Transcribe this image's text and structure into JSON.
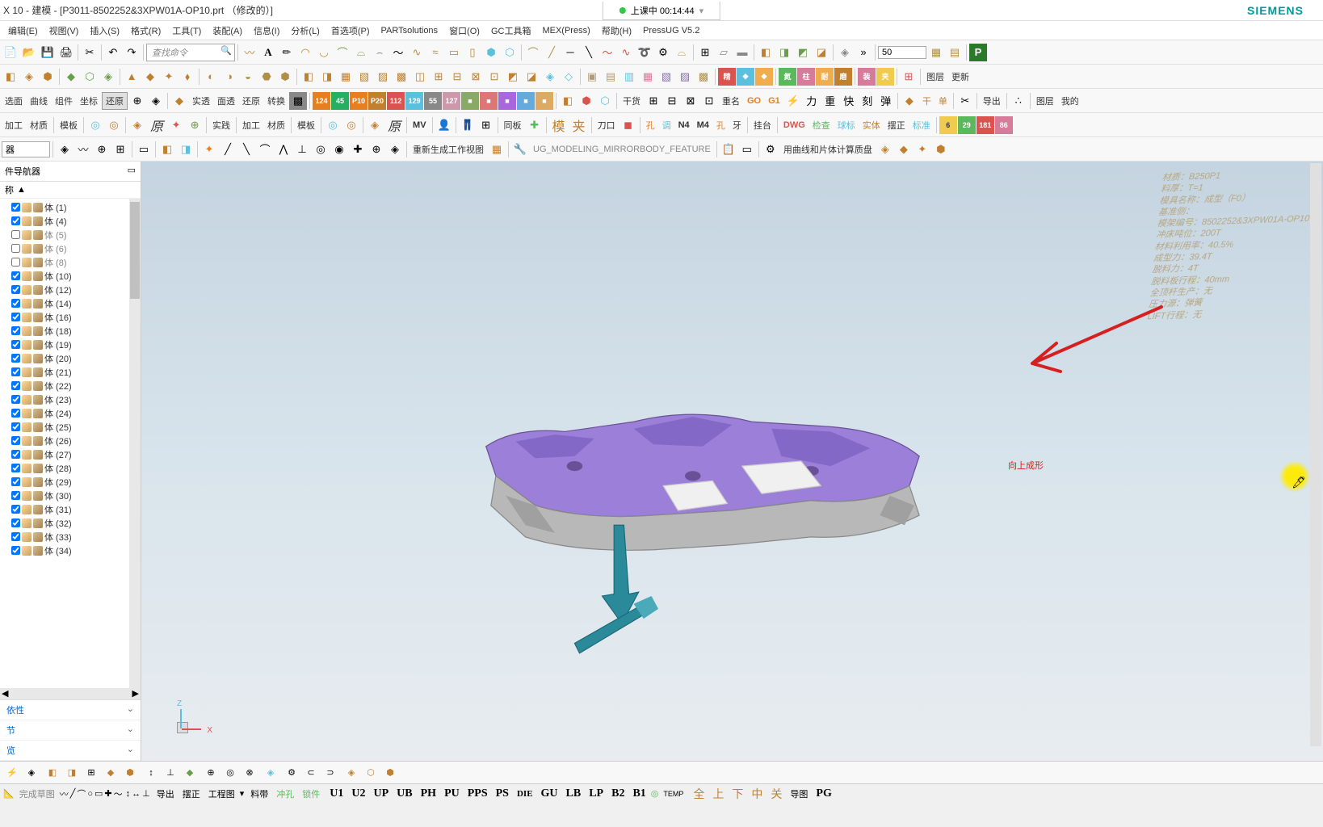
{
  "window": {
    "title": "X 10 - 建模 - [P3011-8502252&3XPW01A-OP10.prt （修改的）]",
    "brand": "SIEMENS"
  },
  "recording": {
    "label": "上课中 00:14:44",
    "arrow": "▾"
  },
  "menu": [
    "编辑(E)",
    "视图(V)",
    "插入(S)",
    "格式(R)",
    "工具(T)",
    "装配(A)",
    "信息(I)",
    "分析(L)",
    "首选项(P)",
    "PARTsolutions",
    "窗口(O)",
    "GC工具箱",
    "MEX(Press)",
    "帮助(H)",
    "PressUG V5.2"
  ],
  "search_placeholder": "查找命令",
  "combo_50": "50",
  "nav": {
    "title": "件导航器",
    "col": "称",
    "items": [
      {
        "label": "体 (1)",
        "checked": true
      },
      {
        "label": "体 (4)",
        "checked": true
      },
      {
        "label": "体 (5)",
        "checked": false
      },
      {
        "label": "体 (6)",
        "checked": false
      },
      {
        "label": "体 (8)",
        "checked": false
      },
      {
        "label": "体 (10)",
        "checked": true
      },
      {
        "label": "体 (12)",
        "checked": true
      },
      {
        "label": "体 (14)",
        "checked": true
      },
      {
        "label": "体 (16)",
        "checked": true
      },
      {
        "label": "体 (18)",
        "checked": true
      },
      {
        "label": "体 (19)",
        "checked": true
      },
      {
        "label": "体 (20)",
        "checked": true
      },
      {
        "label": "体 (21)",
        "checked": true
      },
      {
        "label": "体 (22)",
        "checked": true
      },
      {
        "label": "体 (23)",
        "checked": true
      },
      {
        "label": "体 (24)",
        "checked": true
      },
      {
        "label": "体 (25)",
        "checked": true
      },
      {
        "label": "体 (26)",
        "checked": true
      },
      {
        "label": "体 (27)",
        "checked": true
      },
      {
        "label": "体 (28)",
        "checked": true
      },
      {
        "label": "体 (29)",
        "checked": true
      },
      {
        "label": "体 (30)",
        "checked": true
      },
      {
        "label": "体 (31)",
        "checked": true
      },
      {
        "label": "体 (32)",
        "checked": true
      },
      {
        "label": "体 (33)",
        "checked": true
      },
      {
        "label": "体 (34)",
        "checked": true
      }
    ]
  },
  "accordion": [
    "依性",
    "节",
    "览"
  ],
  "toolbar_labels": {
    "row2_labels": [
      "选面",
      "曲线",
      "组件",
      "坐标",
      "还原",
      "实透",
      "面透",
      "还原",
      "转换",
      "GO",
      "G1"
    ],
    "row3_labels": [
      "加工",
      "材质",
      "模板",
      "原",
      "实践",
      "加工",
      "材质",
      "模板",
      "原",
      "MV",
      "模",
      "夹",
      "刀口",
      "孔",
      "调",
      "N4",
      "M4",
      "孔",
      "牙",
      "挂台",
      "DWG",
      "检查",
      "球标",
      "实体",
      "摆正",
      "标准"
    ],
    "row4_labels": [
      "重新生成工作视图",
      "UG_MODELING_MIRRORBODY_FEATURE",
      "用曲线和片体计算质盘"
    ],
    "row1_extra": [
      "图层",
      "我的"
    ]
  },
  "annotations": [
    "材质：B250P1",
    "料厚：T=1",
    "模具名称：成型（F0）",
    "基准侧：",
    "模架编号：8502252&3XPW01A-OP10",
    "冲床吨位：200T",
    "材料利用率：40.5%",
    "成型力：39.4T",
    "脱料力：4T",
    "脱料板行程：40mm",
    "全顶杆生产：无",
    "压力源：弹簧",
    "LIFT行程：无"
  ],
  "handwriting_text": "向上成形",
  "status": {
    "labels": [
      "导出",
      "摆正",
      "工程图",
      "料带",
      "冲孔",
      "锁件",
      "U1",
      "U2",
      "UP",
      "UB",
      "PH",
      "PU",
      "PPS",
      "PS",
      "DIE",
      "GU",
      "LB",
      "LP",
      "B2",
      "B1",
      "TEMP",
      "全",
      "上",
      "下",
      "中",
      "关",
      "导图",
      "PG"
    ],
    "left": "完成草图"
  },
  "triad": {
    "x": "X",
    "z": "Z"
  }
}
